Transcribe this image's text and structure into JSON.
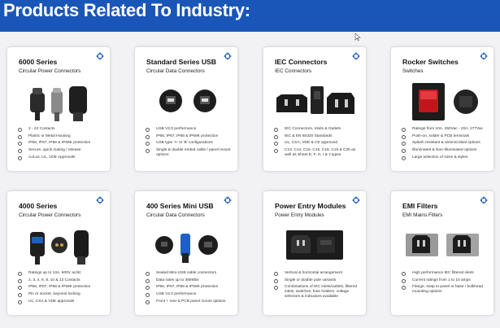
{
  "header": {
    "title": "Products Related To Industry:"
  },
  "cards": [
    {
      "title": "6000 Series",
      "subtitle": "Circular Power Connectors",
      "features": [
        "2 - 22 Contacts",
        "Plastic or Metal Housing",
        "IP66, IP67, IP68 & IP69K protection",
        "Secure, quick mating / release",
        "cULus, UL, VDE Approvals"
      ]
    },
    {
      "title": "Standard Series USB",
      "subtitle": "Circular Data Connectors",
      "features": [
        "USB V2.0 performance",
        "IP66, IP67, IP68 & IP69K protection",
        "USB type 'A' or 'B' configurations",
        "Single & double ended cable / panel mount options"
      ]
    },
    {
      "title": "IEC Connectors",
      "subtitle": "IEC Connectors",
      "features": [
        "IEC Connectors, Inlets & Outlets",
        "IEC & EN 60320 Standards",
        "UL, CSA, VDE & CE approved",
        "C13, C14, C15, C16, C18, C19 & C20 as well as Sheet E, F, H, I & J types"
      ]
    },
    {
      "title": "Rocker Switches",
      "subtitle": "Switches",
      "features": [
        "Ratings from 10A, 250Vac - 20A, 277Vac",
        "Push-on, solder & PCB terminals",
        "Splash resistant & antimicrobial options",
        "Illuminated & Non-Illuminated options",
        "Large selection of sizes & styles"
      ]
    },
    {
      "title": "4000 Series",
      "subtitle": "Circular Power Connectors",
      "features": [
        "Ratings up to 13A, 600V ac/dc",
        "2, 3, 4, 6, 8, 10 & 12 Contacts",
        "IP66, IP67, IP68 & IP69K protection",
        "Pin or socket, bayonet locking",
        "UL, CSA & VDE approvals"
      ]
    },
    {
      "title": "400 Series Mini USB",
      "subtitle": "Circular Data Connectors",
      "features": [
        "Sealed Mini-USB cable connectors",
        "Data rates up to 480Mbs",
        "IP66, IP67, IP68 & IP69K protection",
        "USB V2.0 performance",
        "Front + rear & PCB panel mount options"
      ]
    },
    {
      "title": "Power Entry Modules",
      "subtitle": "Power Entry Modules",
      "features": [
        "Vertical & horizontal arrangement",
        "Single or double pole variants",
        "Combinations of IEC inlets/outlets, filtered inlets, switches, fuse holders, voltage selectors & indicators available"
      ]
    },
    {
      "title": "EMI Filters",
      "subtitle": "EMI Mains Filters",
      "features": [
        "High performance IEC filtered inlets",
        "Current ratings from 1 to 10 amps",
        "Flange, snap to panel or base / bulkhead mounting options"
      ]
    }
  ]
}
